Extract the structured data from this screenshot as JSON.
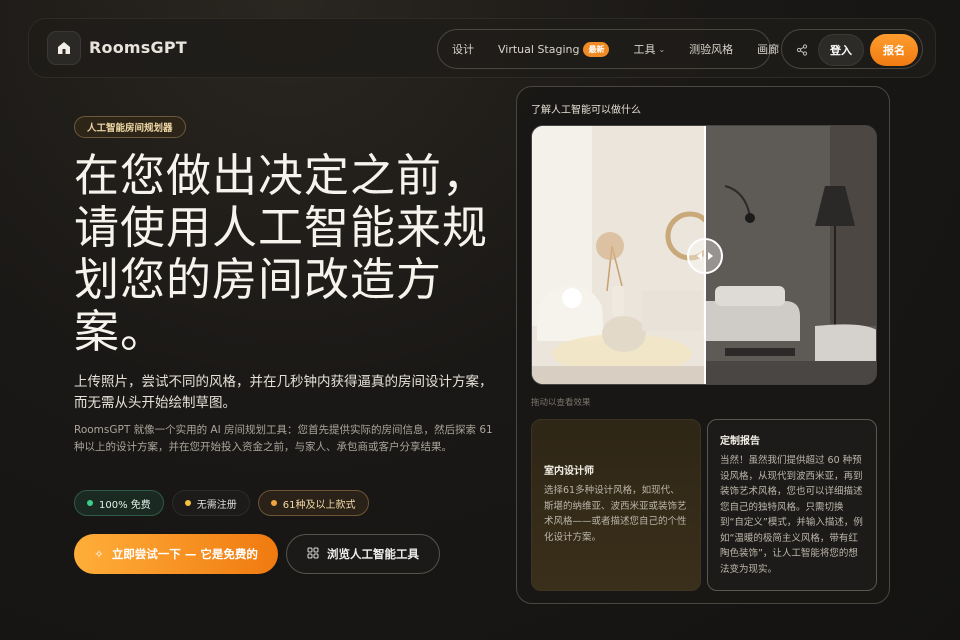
{
  "nav": {
    "brand": "RoomsGPT",
    "items": [
      {
        "label": "设计"
      },
      {
        "label": "Virtual Staging",
        "badge": "最新"
      },
      {
        "label": "工具"
      },
      {
        "label": "测验风格"
      },
      {
        "label": "画廊"
      }
    ],
    "login": "登入",
    "signup": "报名"
  },
  "hero": {
    "tag": "人工智能房间规划器",
    "title": "在您做出决定之前，请使用人工智能来规划您的房间改造方案。",
    "lead": "上传照片，尝试不同的风格，并在几秒钟内获得逼真的房间设计方案，而无需从头开始绘制草图。",
    "description": "RoomsGPT 就像一个实用的 AI 房间规划工具：您首先提供实际的房间信息，然后探索 61 种以上的设计方案，并在您开始投入资金之前，与家人、承包商或客户分享结果。",
    "chips": [
      "100% 免费",
      "无需注册",
      "61种及以上款式"
    ],
    "cta_primary": "立即尝试一下 — 它是免费的",
    "cta_secondary": "浏览人工智能工具"
  },
  "panel": {
    "title": "了解人工智能可以做什么",
    "drag_hint": "拖动以查看效果",
    "cards": [
      {
        "title": "室内设计师",
        "body": "选择61多种设计风格，如现代、斯堪的纳维亚、波西米亚或装饰艺术风格——或者描述您自己的个性化设计方案。"
      },
      {
        "title": "定制报告",
        "body": "当然！虽然我们提供超过 60 种预设风格，从现代到波西米亚，再到装饰艺术风格，您也可以详细描述您自己的独特风格。只需切换到“自定义”模式，并输入描述，例如“温暖的极简主义风格，带有红陶色装饰”，让人工智能将您的想法变为现实。"
      }
    ]
  },
  "colors": {
    "accent": "#f07a10",
    "background": "#161513",
    "tag_text": "#f1d9a6"
  }
}
